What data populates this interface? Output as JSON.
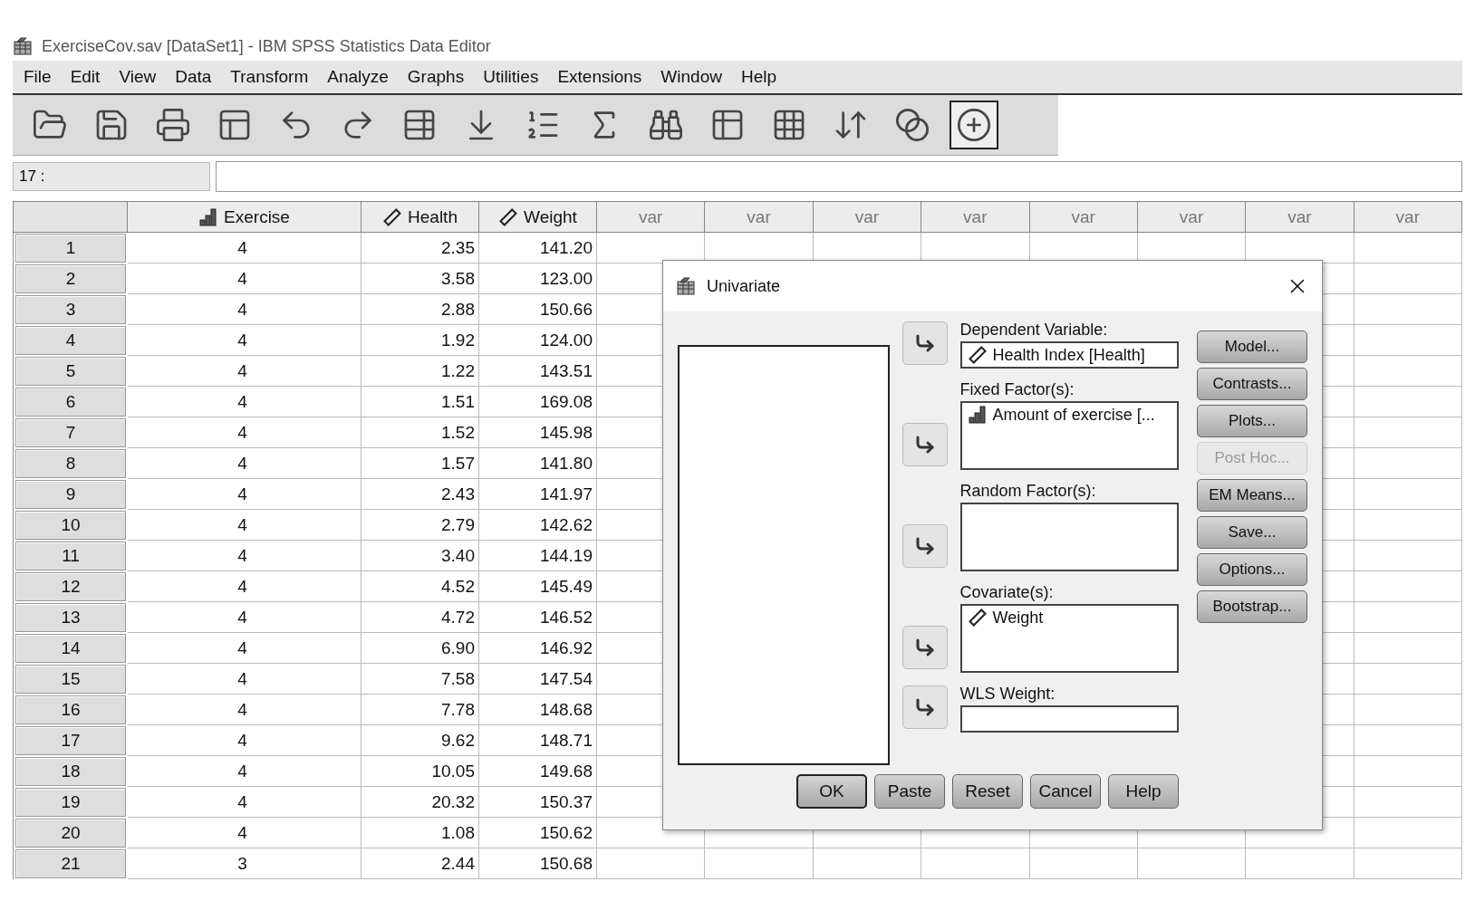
{
  "window": {
    "title": "ExerciseCov.sav [DataSet1] - IBM SPSS Statistics Data Editor"
  },
  "menu": [
    "File",
    "Edit",
    "View",
    "Data",
    "Transform",
    "Analyze",
    "Graphs",
    "Utilities",
    "Extensions",
    "Window",
    "Help"
  ],
  "cell_reference": "17 :",
  "columns": [
    {
      "kind": "nominal",
      "label": "Exercise"
    },
    {
      "kind": "scale",
      "label": "Health"
    },
    {
      "kind": "scale",
      "label": "Weight"
    },
    {
      "kind": "empty",
      "label": "var"
    },
    {
      "kind": "empty",
      "label": "var"
    },
    {
      "kind": "empty",
      "label": "var"
    },
    {
      "kind": "empty",
      "label": "var"
    },
    {
      "kind": "empty",
      "label": "var"
    },
    {
      "kind": "empty",
      "label": "var"
    },
    {
      "kind": "empty",
      "label": "var"
    },
    {
      "kind": "empty",
      "label": "var"
    }
  ],
  "rows": [
    [
      "1",
      "4",
      "2.35",
      "141.20"
    ],
    [
      "2",
      "4",
      "3.58",
      "123.00"
    ],
    [
      "3",
      "4",
      "2.88",
      "150.66"
    ],
    [
      "4",
      "4",
      "1.92",
      "124.00"
    ],
    [
      "5",
      "4",
      "1.22",
      "143.51"
    ],
    [
      "6",
      "4",
      "1.51",
      "169.08"
    ],
    [
      "7",
      "4",
      "1.52",
      "145.98"
    ],
    [
      "8",
      "4",
      "1.57",
      "141.80"
    ],
    [
      "9",
      "4",
      "2.43",
      "141.97"
    ],
    [
      "10",
      "4",
      "2.79",
      "142.62"
    ],
    [
      "11",
      "4",
      "3.40",
      "144.19"
    ],
    [
      "12",
      "4",
      "4.52",
      "145.49"
    ],
    [
      "13",
      "4",
      "4.72",
      "146.52"
    ],
    [
      "14",
      "4",
      "6.90",
      "146.92"
    ],
    [
      "15",
      "4",
      "7.58",
      "147.54"
    ],
    [
      "16",
      "4",
      "7.78",
      "148.68"
    ],
    [
      "17",
      "4",
      "9.62",
      "148.71"
    ],
    [
      "18",
      "4",
      "10.05",
      "149.68"
    ],
    [
      "19",
      "4",
      "20.32",
      "150.37"
    ],
    [
      "20",
      "4",
      "1.08",
      "150.62"
    ],
    [
      "21",
      "3",
      "2.44",
      "150.68"
    ]
  ],
  "dialog": {
    "title": "Univariate",
    "targets": [
      {
        "label": "Dependent Variable:",
        "kind": "single",
        "items": [
          {
            "kind": "scale",
            "text": "Health Index [Health]"
          }
        ]
      },
      {
        "label": "Fixed Factor(s):",
        "kind": "list",
        "items": [
          {
            "kind": "nominal",
            "text": "Amount of exercise [..."
          }
        ]
      },
      {
        "label": "Random Factor(s):",
        "kind": "list"
      },
      {
        "label": "Covariate(s):",
        "kind": "list",
        "items": [
          {
            "kind": "scale",
            "text": "Weight"
          }
        ]
      },
      {
        "label": "WLS Weight:",
        "kind": "single"
      }
    ],
    "side_buttons": [
      {
        "label": "Model...",
        "disabled": false
      },
      {
        "label": "Contrasts...",
        "disabled": false
      },
      {
        "label": "Plots...",
        "disabled": false
      },
      {
        "label": "Post Hoc...",
        "disabled": true
      },
      {
        "label": "EM Means...",
        "disabled": false
      },
      {
        "label": "Save...",
        "disabled": false
      },
      {
        "label": "Options...",
        "disabled": false
      },
      {
        "label": "Bootstrap...",
        "disabled": false
      }
    ],
    "buttons": [
      {
        "label": "OK",
        "selected": true
      },
      {
        "label": "Paste",
        "selected": false
      },
      {
        "label": "Reset",
        "selected": false
      },
      {
        "label": "Cancel",
        "selected": false
      },
      {
        "label": "Help",
        "selected": false
      }
    ]
  }
}
